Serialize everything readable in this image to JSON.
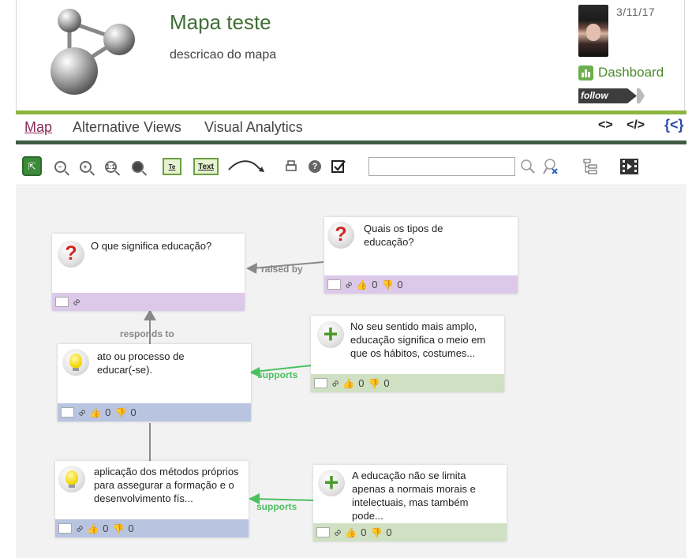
{
  "map": {
    "title": "Mapa teste",
    "description": "descricao do mapa",
    "date": "3/11/17",
    "dashboard_label": "Dashboard",
    "follow_label": "follow"
  },
  "tabs": [
    {
      "label": "Map",
      "active": true
    },
    {
      "label": "Alternative Views",
      "active": false
    },
    {
      "label": "Visual Analytics",
      "active": false
    }
  ],
  "tab_actions": {
    "embed": "<>",
    "edit_embed": "</>",
    "share": "{<}"
  },
  "toolbar": {
    "text_button": "Text",
    "search_value": "",
    "zoom_actual_label": "1:1"
  },
  "colors": {
    "accent_green": "#8cb53f",
    "question_footer": "#dcc9ea",
    "idea_footer": "#b9c4e1",
    "pro_footer": "#cfe0c3",
    "support_edge": "#4cc061",
    "neutral_edge": "#888888"
  },
  "nodes": [
    {
      "type": "question",
      "icon": "question-icon",
      "text": "O que significa educação?",
      "likes": null,
      "dislikes": null
    },
    {
      "type": "question",
      "icon": "question-icon",
      "text": "Quais os tipos de educação?",
      "likes": "0",
      "dislikes": "0"
    },
    {
      "type": "pro",
      "icon": "plus-icon",
      "text": "No seu sentido mais amplo, educação significa o meio em que os hábitos, costumes...",
      "likes": "0",
      "dislikes": "0"
    },
    {
      "type": "idea",
      "icon": "lightbulb-icon",
      "text": "ato ou processo de educar(-se).",
      "likes": "0",
      "dislikes": "0"
    },
    {
      "type": "idea",
      "icon": "lightbulb-icon",
      "text": "aplicação dos métodos próprios para assegurar a formação e o desenvolvimento fís...",
      "likes": "0",
      "dislikes": "0"
    },
    {
      "type": "pro",
      "icon": "plus-icon",
      "text": "A educação não se limita apenas a normais morais e intelectuais, mas também pode...",
      "likes": "0",
      "dislikes": "0"
    }
  ],
  "edges": [
    {
      "label": "raised by"
    },
    {
      "label": "responds to"
    },
    {
      "label": "supports"
    },
    {
      "label": "supports"
    }
  ]
}
